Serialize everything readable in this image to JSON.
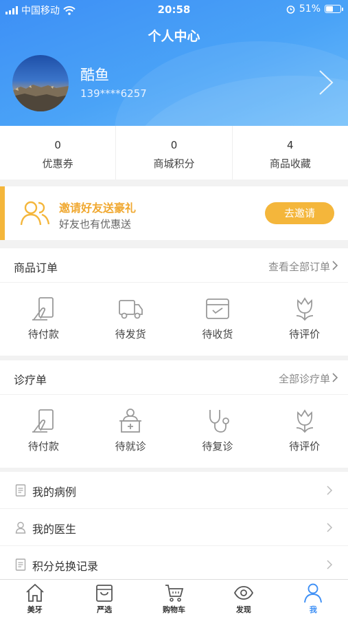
{
  "status_bar": {
    "carrier": "中国移动",
    "time": "20:58",
    "battery": "51%",
    "battery_level": 0.51
  },
  "page_title": "个人中心",
  "profile": {
    "name": "酷鱼",
    "phone": "139****6257"
  },
  "stats": [
    {
      "value": "0",
      "label": "优惠券"
    },
    {
      "value": "0",
      "label": "商城积分"
    },
    {
      "value": "4",
      "label": "商品收藏"
    }
  ],
  "invite": {
    "title": "邀请好友送豪礼",
    "subtitle": "好友也有优惠送",
    "button": "去邀请"
  },
  "orders": {
    "title": "商品订单",
    "more": "查看全部订单",
    "items": [
      {
        "label": "待付款",
        "icon": "payment-card-icon"
      },
      {
        "label": "待发货",
        "icon": "truck-icon"
      },
      {
        "label": "待收货",
        "icon": "package-box-icon"
      },
      {
        "label": "待评价",
        "icon": "tulip-icon"
      }
    ]
  },
  "treatments": {
    "title": "诊疗单",
    "more": "全部诊疗单",
    "items": [
      {
        "label": "待付款",
        "icon": "payment-card-icon"
      },
      {
        "label": "待就诊",
        "icon": "clinic-desk-icon"
      },
      {
        "label": "待复诊",
        "icon": "stethoscope-icon"
      },
      {
        "label": "待评价",
        "icon": "tulip-icon"
      }
    ]
  },
  "menu": [
    {
      "label": "我的病例",
      "icon": "document-icon"
    },
    {
      "label": "我的医生",
      "icon": "person-icon"
    },
    {
      "label": "积分兑换记录",
      "icon": "document-icon"
    }
  ],
  "tabbar": [
    {
      "label": "美牙",
      "icon": "home-icon",
      "active": false
    },
    {
      "label": "严选",
      "icon": "shopping-bag-icon",
      "active": false
    },
    {
      "label": "购物车",
      "icon": "cart-icon",
      "active": false
    },
    {
      "label": "发现",
      "icon": "eye-icon",
      "active": false
    },
    {
      "label": "我",
      "icon": "user-icon",
      "active": true
    }
  ],
  "colors": {
    "primary": "#3d8ff5",
    "accent": "#f4b63b",
    "icon_gray": "#999999"
  }
}
